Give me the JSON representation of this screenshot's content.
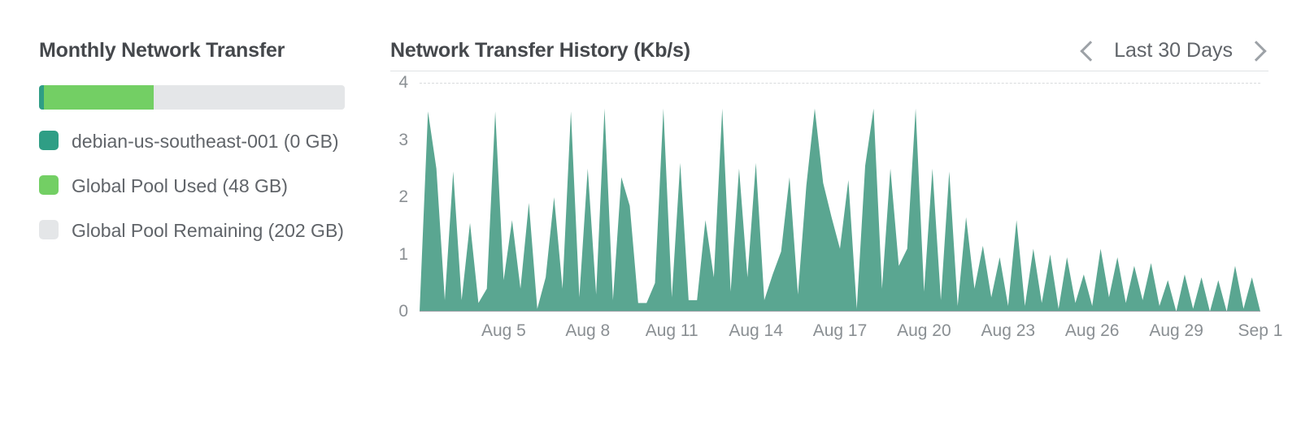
{
  "left": {
    "title": "Monthly Network Transfer",
    "bar": {
      "seg1_pct": 1.5,
      "seg2_pct": 36
    },
    "items": [
      {
        "swatch": "sw-a",
        "label": "debian-us-southeast-001 (0 GB)"
      },
      {
        "swatch": "sw-b",
        "label": "Global Pool Used (48 GB)"
      },
      {
        "swatch": "sw-c",
        "label": "Global Pool Remaining (202 GB)"
      }
    ]
  },
  "right": {
    "title": "Network Transfer History (Kb/s)",
    "range_label": "Last 30 Days"
  },
  "colors": {
    "chart_fill": "#4c9e88",
    "grid": "#d8dbdd",
    "axis": "#9da2a7"
  },
  "chart_data": {
    "type": "area",
    "title": "Network Transfer History (Kb/s)",
    "xlabel": "",
    "ylabel": "",
    "ylim": [
      0,
      4
    ],
    "y_ticks": [
      0,
      1,
      2,
      3,
      4
    ],
    "x_ticks": [
      "Aug 5",
      "Aug 8",
      "Aug 11",
      "Aug 14",
      "Aug 17",
      "Aug 20",
      "Aug 23",
      "Aug 26",
      "Aug 29",
      "Sep 1"
    ],
    "x_range": [
      "Aug 2",
      "Sep 1"
    ],
    "values": [
      0.0,
      3.5,
      2.5,
      0.2,
      2.45,
      0.2,
      1.55,
      0.15,
      0.4,
      3.5,
      0.55,
      1.6,
      0.4,
      1.9,
      0.05,
      0.6,
      2.0,
      0.4,
      3.5,
      0.25,
      2.5,
      0.3,
      3.55,
      0.2,
      2.35,
      1.85,
      0.15,
      0.15,
      0.5,
      3.55,
      0.25,
      2.6,
      0.2,
      0.2,
      1.6,
      0.6,
      3.55,
      0.35,
      2.5,
      0.6,
      2.6,
      0.2,
      0.65,
      1.05,
      2.35,
      0.3,
      2.2,
      3.55,
      2.25,
      1.65,
      1.1,
      2.3,
      0.05,
      2.55,
      3.55,
      0.4,
      2.5,
      0.8,
      1.1,
      3.55,
      0.35,
      2.5,
      0.2,
      2.45,
      0.1,
      1.65,
      0.4,
      1.15,
      0.25,
      0.95,
      0.1,
      1.6,
      0.1,
      1.1,
      0.15,
      1.0,
      0.05,
      0.95,
      0.15,
      0.65,
      0.1,
      1.1,
      0.25,
      0.95,
      0.15,
      0.8,
      0.2,
      0.85,
      0.1,
      0.55,
      0.0,
      0.65,
      0.05,
      0.6,
      0.0,
      0.55,
      0.0,
      0.8,
      0.05,
      0.6,
      0.0
    ]
  }
}
